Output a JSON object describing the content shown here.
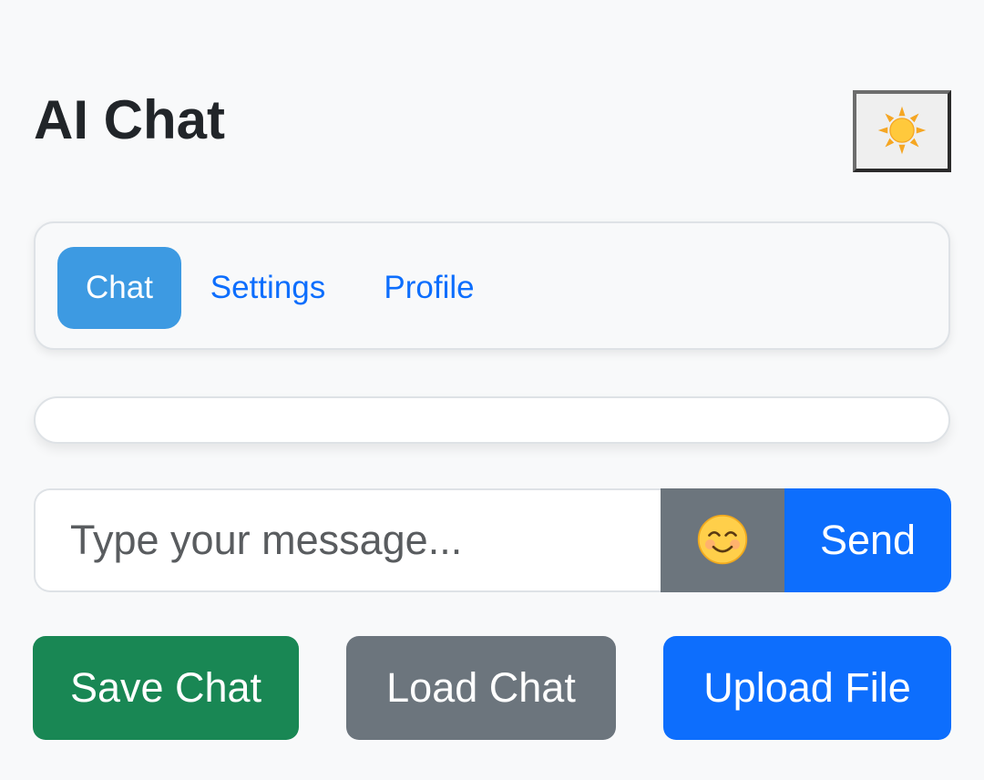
{
  "header": {
    "title": "AI Chat",
    "theme_toggle_icon": "sun-icon"
  },
  "nav": {
    "tabs": [
      {
        "label": "Chat",
        "active": true
      },
      {
        "label": "Settings",
        "active": false
      },
      {
        "label": "Profile",
        "active": false
      }
    ]
  },
  "composer": {
    "placeholder": "Type your message...",
    "value": "",
    "emoji_icon": "smiling-face-icon",
    "send_label": "Send"
  },
  "actions": {
    "save_label": "Save Chat",
    "load_label": "Load Chat",
    "upload_label": "Upload File"
  },
  "colors": {
    "background": "#f8f9fa",
    "primary": "#0d6efd",
    "active_tab": "#3d9ae2",
    "success": "#198754",
    "secondary": "#6c757d"
  }
}
